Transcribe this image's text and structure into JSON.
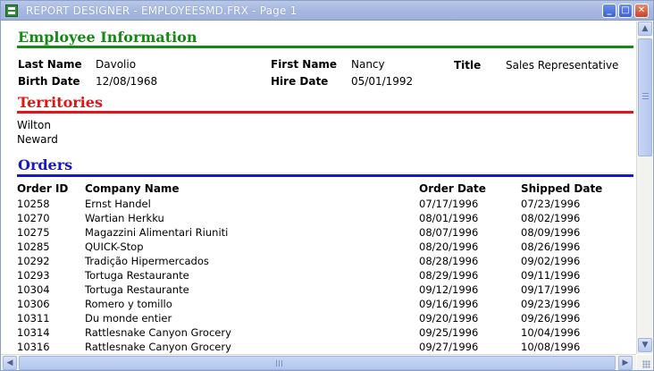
{
  "window": {
    "title": "REPORT DESIGNER - EMPLOYEESMD.FRX - Page 1",
    "minimize_label": "_",
    "maximize_label": "□",
    "close_label": "✕"
  },
  "colors": {
    "employee_section": "#138a13",
    "territories_section": "#e01515",
    "orders_section": "#1818c8"
  },
  "employee": {
    "section_title": "Employee Information",
    "last_name_label": "Last Name",
    "last_name": "Davolio",
    "first_name_label": "First Name",
    "first_name": "Nancy",
    "title_label": "Title",
    "title": "Sales Representative",
    "birth_date_label": "Birth Date",
    "birth_date": "12/08/1968",
    "hire_date_label": "Hire Date",
    "hire_date": "05/01/1992"
  },
  "territories": {
    "section_title": "Territories",
    "items": [
      "Wilton",
      "Neward"
    ]
  },
  "orders": {
    "section_title": "Orders",
    "columns": [
      "Order ID",
      "Company Name",
      "Order Date",
      "Shipped Date"
    ],
    "rows": [
      [
        "10258",
        "Ernst Handel",
        "07/17/1996",
        "07/23/1996"
      ],
      [
        "10270",
        "Wartian Herkku",
        "08/01/1996",
        "08/02/1996"
      ],
      [
        "10275",
        "Magazzini Alimentari Riuniti",
        "08/07/1996",
        "08/09/1996"
      ],
      [
        "10285",
        "QUICK-Stop",
        "08/20/1996",
        "08/26/1996"
      ],
      [
        "10292",
        "Tradição Hipermercados",
        "08/28/1996",
        "09/02/1996"
      ],
      [
        "10293",
        "Tortuga Restaurante",
        "08/29/1996",
        "09/11/1996"
      ],
      [
        "10304",
        "Tortuga Restaurante",
        "09/12/1996",
        "09/17/1996"
      ],
      [
        "10306",
        "Romero y tomillo",
        "09/16/1996",
        "09/23/1996"
      ],
      [
        "10311",
        "Du monde entier",
        "09/20/1996",
        "09/26/1996"
      ],
      [
        "10314",
        "Rattlesnake Canyon Grocery",
        "09/25/1996",
        "10/04/1996"
      ],
      [
        "10316",
        "Rattlesnake Canyon Grocery",
        "09/27/1996",
        "10/08/1996"
      ]
    ]
  },
  "scrollbars": {
    "up_icon": "▲",
    "down_icon": "▼",
    "left_icon": "◀",
    "right_icon": "▶"
  }
}
